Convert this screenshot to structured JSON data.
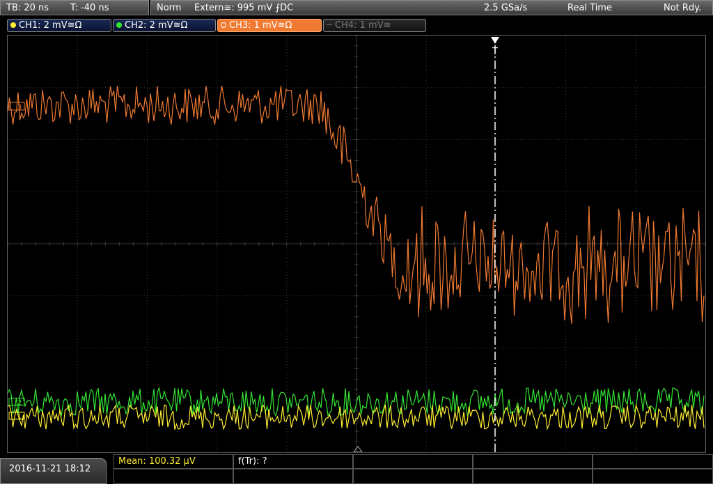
{
  "top_bar": {
    "timebase": "TB: 20 ns",
    "trigger_time": "T: -40 ns",
    "trigger_mode": "Norm",
    "trigger_source": "Extern≅: 995 mV ⨍DC",
    "sample_rate": "2.5 GSa/s",
    "acq_mode": "Real Time",
    "status": "Not Rdy."
  },
  "channels": [
    {
      "label": "CH1: 2 mV≅Ω",
      "color": "#ffee33",
      "active": true
    },
    {
      "label": "CH2: 2 mV≅Ω",
      "color": "#33e633",
      "active": true
    },
    {
      "label": "CH3: 1 mV≅Ω",
      "color": "#f07a32",
      "active": true
    },
    {
      "label": "CH4: 1 mV≅",
      "color": "#666666",
      "active": false
    }
  ],
  "markers": {
    "trigger_marker": "T",
    "ch3_marker": "3",
    "ch2_marker": "2",
    "ch1_marker": "1"
  },
  "bottom_bar": {
    "datetime": "2016-11-21 18:12",
    "mean": "Mean: 100.32 µV",
    "rise_time": "f(Tr): ?"
  },
  "colors": {
    "grid": "#3a3a3a",
    "ch1": "#ffee33",
    "ch2": "#33e633",
    "ch3": "#f07a32",
    "trigger_line": "#ffffff"
  }
}
